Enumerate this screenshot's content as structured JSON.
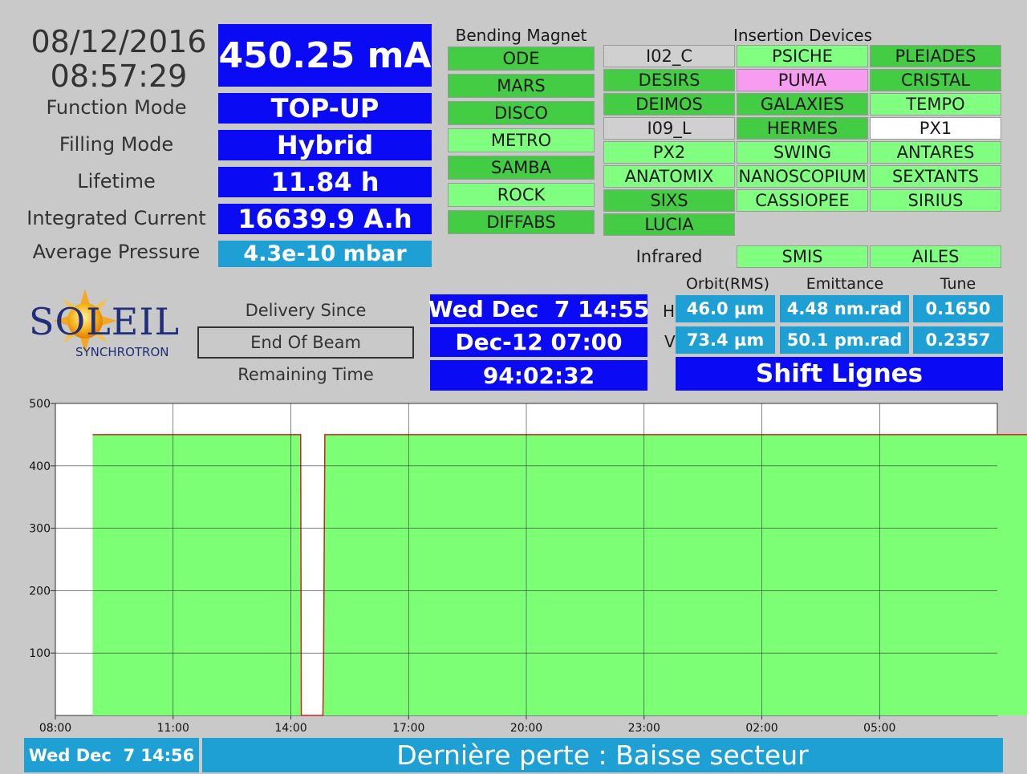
{
  "clock": {
    "date": "08/12/2016",
    "time": "08:57:29"
  },
  "beam_current": "450.25 mA",
  "params": [
    {
      "label": "Function Mode",
      "value": "TOP-UP",
      "style": "blue"
    },
    {
      "label": "Filling Mode",
      "value": "Hybrid",
      "style": "blue"
    },
    {
      "label": "Lifetime",
      "value": "11.84 h",
      "style": "blue"
    },
    {
      "label": "Integrated Current",
      "value": "16639.9 A.h",
      "style": "blue"
    },
    {
      "label": "Average Pressure",
      "value": "4.3e-10 mbar",
      "style": "cyan"
    }
  ],
  "bending_magnet": {
    "title": "Bending Magnet",
    "items": [
      {
        "name": "ODE",
        "state": "dark"
      },
      {
        "name": "MARS",
        "state": "dark"
      },
      {
        "name": "DISCO",
        "state": "dark"
      },
      {
        "name": "METRO",
        "state": "light"
      },
      {
        "name": "SAMBA",
        "state": "dark"
      },
      {
        "name": "ROCK",
        "state": "light"
      },
      {
        "name": "DIFFABS",
        "state": "dark"
      }
    ]
  },
  "insertion_devices": {
    "title": "Insertion Devices",
    "rows": [
      [
        {
          "name": "I02_C",
          "state": "gray"
        },
        {
          "name": "PSICHE",
          "state": "light"
        },
        {
          "name": "PLEIADES",
          "state": "dark"
        }
      ],
      [
        {
          "name": "DESIRS",
          "state": "dark"
        },
        {
          "name": "PUMA",
          "state": "pink"
        },
        {
          "name": "CRISTAL",
          "state": "dark"
        }
      ],
      [
        {
          "name": "DEIMOS",
          "state": "dark"
        },
        {
          "name": "GALAXIES",
          "state": "dark"
        },
        {
          "name": "TEMPO",
          "state": "light"
        }
      ],
      [
        {
          "name": "I09_L",
          "state": "gray"
        },
        {
          "name": "HERMES",
          "state": "dark"
        },
        {
          "name": "PX1",
          "state": "white"
        }
      ],
      [
        {
          "name": "PX2",
          "state": "light"
        },
        {
          "name": "SWING",
          "state": "light"
        },
        {
          "name": "ANTARES",
          "state": "light"
        }
      ],
      [
        {
          "name": "ANATOMIX",
          "state": "light"
        },
        {
          "name": "NANOSCOPIUM",
          "state": "light"
        },
        {
          "name": "SEXTANTS",
          "state": "light"
        }
      ],
      [
        {
          "name": "SIXS",
          "state": "dark"
        },
        {
          "name": "CASSIOPEE",
          "state": "light"
        },
        {
          "name": "SIRIUS",
          "state": "light"
        }
      ],
      [
        {
          "name": "LUCIA",
          "state": "dark"
        }
      ]
    ]
  },
  "infrared": {
    "label": "Infrared",
    "items": [
      {
        "name": "SMIS",
        "state": "light"
      },
      {
        "name": "AILES",
        "state": "light"
      }
    ]
  },
  "logo": {
    "main": "SOLEIL",
    "sub": "SYNCHROTRON"
  },
  "delivery": {
    "since_label": "Delivery Since",
    "end_label": "End Of Beam",
    "remaining_label": "Remaining Time",
    "since_value": "Wed Dec  7 14:55",
    "end_value": "Dec-12 07:00",
    "remaining_value": "94:02:32"
  },
  "beam_params": {
    "headers": [
      "Orbit(RMS)",
      "Emittance",
      "Tune"
    ],
    "h_label": "H",
    "v_label": "V",
    "h": [
      "46.0 µm",
      "4.48 nm.rad",
      "0.1650"
    ],
    "v": [
      "73.4 µm",
      "50.1 pm.rad",
      "0.2357"
    ]
  },
  "shift": "Shift Lignes",
  "footer": {
    "timestamp": "Wed Dec  7 14:56",
    "message": "Dernière perte : Baisse secteur"
  },
  "colors": {
    "fill": "#7cff74",
    "line": "#cc2222",
    "panel_blue": "#0a0af5",
    "panel_cyan": "#1fa0d4"
  },
  "chart_data": {
    "type": "area",
    "title": "",
    "xlabel": "",
    "ylabel": "",
    "ylim": [
      0,
      500
    ],
    "yticks": [
      100,
      200,
      300,
      400,
      500
    ],
    "xlim_hours": [
      8.0,
      8.0
    ],
    "xticks": [
      "11:00",
      "14:00",
      "17:00",
      "20:00",
      "23:00",
      "02:00",
      "05:00",
      "08:00"
    ],
    "grid": true,
    "series": [
      {
        "name": "",
        "x": [
          "08:57",
          "14:15",
          "14:16",
          "14:49",
          "14:50",
          "14:52",
          "08:57"
        ],
        "values": [
          450,
          450,
          0,
          0,
          80,
          450,
          450
        ]
      }
    ]
  }
}
